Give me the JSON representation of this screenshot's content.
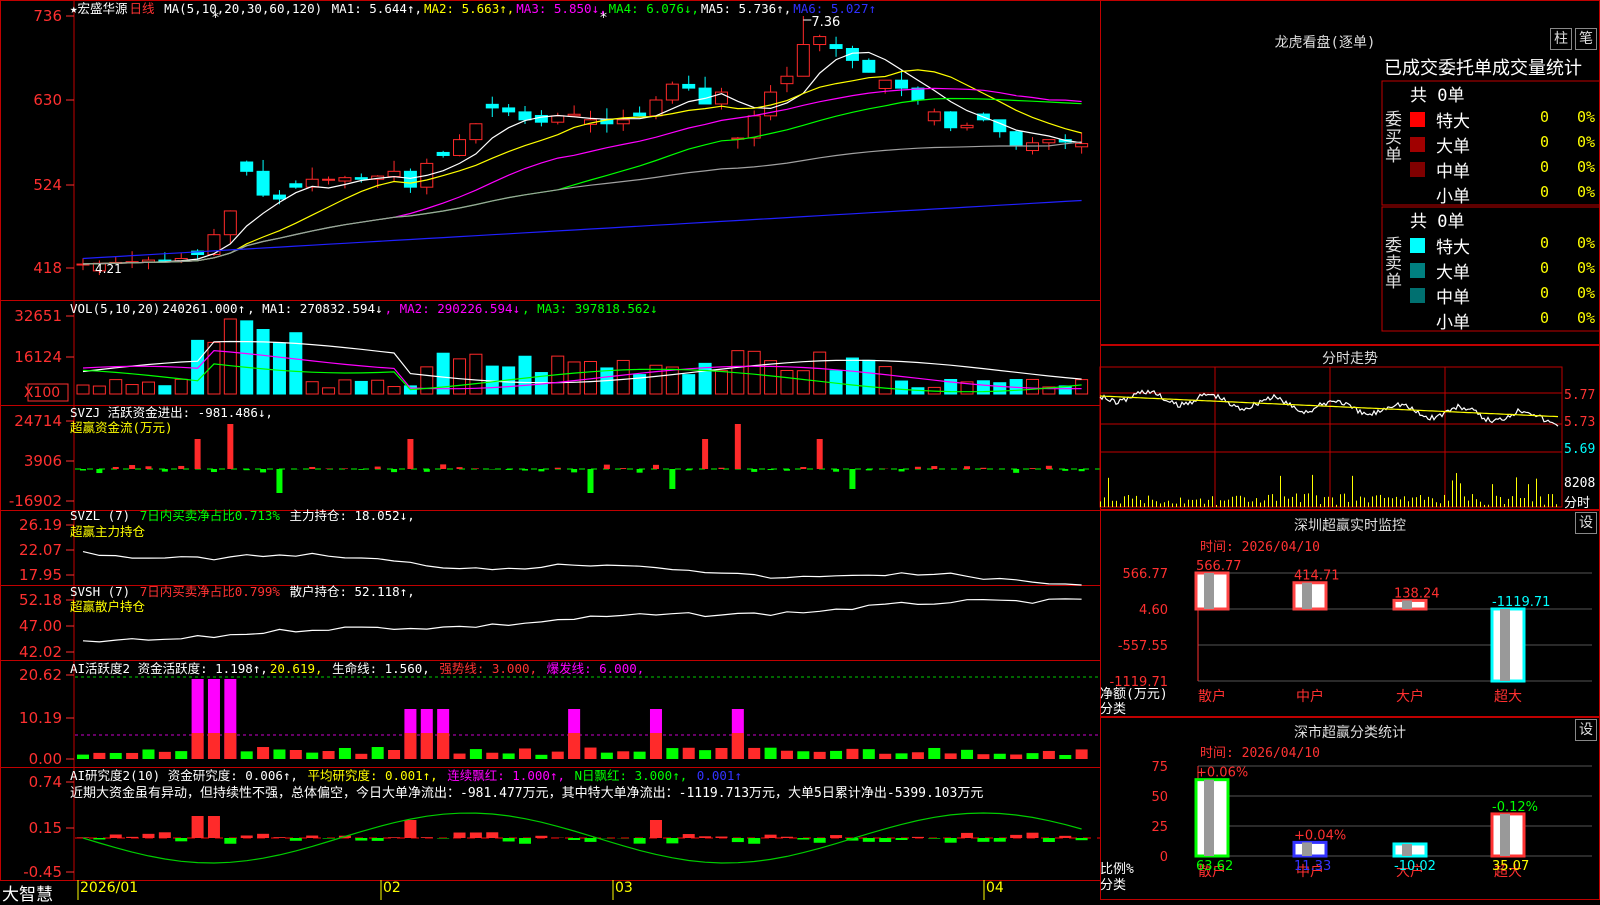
{
  "stock": {
    "title": "★宏盛华源",
    "period": "日线",
    "star": "★"
  },
  "colors": {
    "up": "#ff2a2a",
    "down": "#00ffff",
    "panel_border": "#c00000",
    "axis_text": "#ff3030",
    "ma1": "#ffffff",
    "ma2": "#ffff00",
    "ma3": "#ff00ff",
    "ma4": "#00ff00",
    "ma5": "#a0a0a0",
    "ma6": "#2020ff"
  },
  "main": {
    "ma_label": "MA(5,10,20,30,60,120)",
    "ma": [
      {
        "label": "MA1: 5.644↑",
        "color": "#ffffff"
      },
      {
        "label": "MA2: 5.663↑",
        "color": "#ffff00"
      },
      {
        "label": "MA3: 5.850↓",
        "color": "#ff00ff"
      },
      {
        "label": "MA4: 6.076↓",
        "color": "#00ff00"
      },
      {
        "label": "MA5: 5.736↑",
        "color": "#ffffff"
      },
      {
        "label": "MA6: 5.027↑",
        "color": "#3030ff"
      }
    ],
    "y_ticks": [
      "736",
      "630",
      "524",
      "418"
    ],
    "high_label": "7.36",
    "low_label": "4.21"
  },
  "vol": {
    "label": "VOL(5,10,20)",
    "value": "240261.000↑",
    "ma1": ", MA1: 270832.594↓",
    "ma2": ", MA2: 290226.594↓",
    "ma3": ", MA3: 397818.562↓",
    "y_ticks": [
      "32651",
      "16124"
    ],
    "unit": "X100"
  },
  "svzj": {
    "l1": "SVZJ  活跃资金进出: -981.486↓,",
    "l2": "超赢资金流(万元)",
    "y_ticks": [
      "24714",
      "3906",
      "-16902"
    ]
  },
  "svzl": {
    "l1": "SVZL (7)",
    "l1b": "7日内买卖净占比0.713%",
    "l1c": "主力持仓: 18.052↓,",
    "l2": "超赢主力持仓",
    "y_ticks": [
      "26.19",
      "22.07",
      "17.95"
    ]
  },
  "svsh": {
    "l1": "SVSH (7)",
    "l1b": "7日内买卖净占比0.799%",
    "l1c": "散户持仓: 52.118↑,",
    "l2": "超赢散户持仓",
    "y_ticks": [
      "52.18",
      "47.00",
      "42.02"
    ]
  },
  "ai1": {
    "l1": "AI活跃度2 资金活跃度: 1.198↑,",
    "l1b": "20.619,",
    "l1c": "生命线: 1.560,",
    "l1d": "强势线: 3.000,",
    "l1e": "爆发线: 6.000,",
    "y_ticks": [
      "20.62",
      "10.19",
      "0.00"
    ]
  },
  "ai2": {
    "l1": "AI研究度2(10) 资金研究度: 0.006↑,",
    "l1b": "平均研究度: 0.001↑,",
    "l1c": "连续飘红: 1.000↑,",
    "l1d": "N日飘红: 3.000↑,",
    "l1e": "0.001↑",
    "note": "近期大资金虽有异动，但持续性不强，总体偏空，今日大单净流出：-981.477万元，其中特大单净流出：-1119.713万元，大单5日累计净出-5399.103万元",
    "y_ticks": [
      "0.74",
      "0.15",
      "-0.45"
    ]
  },
  "xaxis": {
    "labels": [
      "2026/01",
      "02",
      "03",
      "04"
    ],
    "brand": "大智慧"
  },
  "right": {
    "lhkp": {
      "title": "龙虎看盘(逐单)",
      "btn1": "柱",
      "btn2": "笔",
      "sub": "已成交委托单成交量统计",
      "buy": {
        "side": "委买单",
        "total": "共 0单",
        "rows": [
          {
            "name": "特大",
            "v": "0",
            "p": "0%",
            "color": "#ff0000"
          },
          {
            "name": "大单",
            "v": "0",
            "p": "0%",
            "color": "#a00000"
          },
          {
            "name": "中单",
            "v": "0",
            "p": "0%",
            "color": "#800000"
          },
          {
            "name": "小单",
            "v": "0",
            "p": "0%",
            "color": "#000000"
          }
        ]
      },
      "sell": {
        "side": "委卖单",
        "total": "共 0单",
        "rows": [
          {
            "name": "特大",
            "v": "0",
            "p": "0%",
            "color": "#00ffff"
          },
          {
            "name": "大单",
            "v": "0",
            "p": "0%",
            "color": "#008080"
          },
          {
            "name": "中单",
            "v": "0",
            "p": "0%",
            "color": "#007070"
          },
          {
            "name": "小单",
            "v": "0",
            "p": "0%",
            "color": "#000000"
          }
        ]
      }
    },
    "fenshi": {
      "title": "分时走势",
      "p1": "5.77",
      "p2": "5.73",
      "p3": "5.69",
      "vol": "8208",
      "vl": "分时"
    },
    "szcy": {
      "title": "深圳超赢实时监控",
      "btn": "设",
      "time": "时间: 2026/04/10",
      "y_ticks": [
        "566.77",
        "4.60",
        "-557.55",
        "-1119.71"
      ],
      "ylabel": "净额(万元)",
      "xlabel": "分类",
      "chart_data": {
        "type": "bar",
        "categories": [
          "散户",
          "中户",
          "大户",
          "超大"
        ],
        "values": [
          566.77,
          414.71,
          138.24,
          -1119.71
        ],
        "ylim": [
          -1119.71,
          566.77
        ]
      }
    },
    "scfl": {
      "title": "深市超赢分类统计",
      "btn": "设",
      "time": "时间: 2026/04/10",
      "y_ticks": [
        "75",
        "50",
        "25",
        "0"
      ],
      "ylabel": "比例%",
      "xlabel": "分类",
      "chart_data": {
        "type": "bar",
        "categories": [
          "散户",
          "中户",
          "大户",
          "超大"
        ],
        "values": [
          63.62,
          11.33,
          -10.02,
          35.07
        ],
        "bar_labels": [
          "+0.06%",
          "+0.04%",
          "",
          "-0.12%"
        ],
        "bottom": [
          "63.62",
          "11.33",
          "-10.02",
          "35.07"
        ],
        "ylim": [
          0,
          75
        ]
      }
    }
  }
}
